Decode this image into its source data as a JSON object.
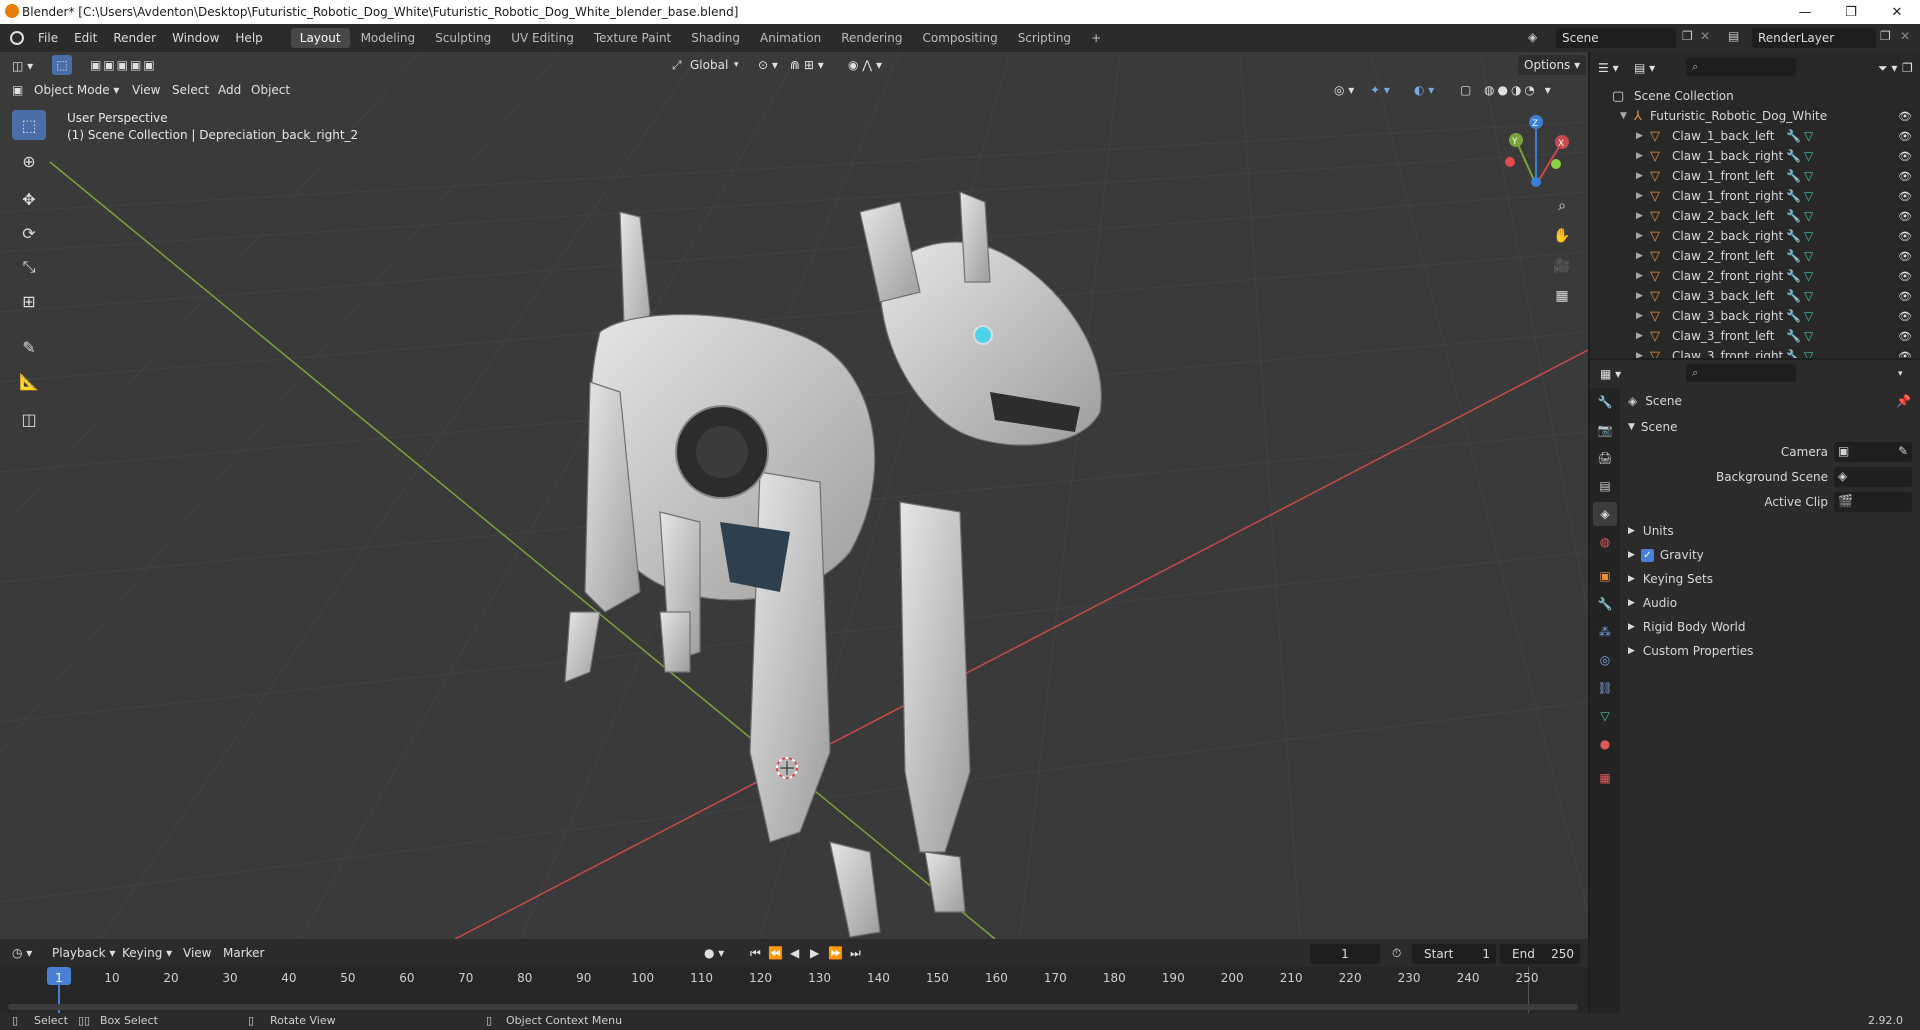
{
  "window": {
    "title": "Blender* [C:\\Users\\Avdenton\\Desktop\\Futuristic_Robotic_Dog_White\\Futuristic_Robotic_Dog_White_blender_base.blend]",
    "controls": [
      "—",
      "❐",
      "✕"
    ]
  },
  "topbar": {
    "menus": [
      "File",
      "Edit",
      "Render",
      "Window",
      "Help"
    ],
    "workspaces": [
      "Layout",
      "Modeling",
      "Sculpting",
      "UV Editing",
      "Texture Paint",
      "Shading",
      "Animation",
      "Rendering",
      "Compositing",
      "Scripting"
    ],
    "active_workspace": "Layout",
    "add_workspace": "+",
    "scene": "Scene",
    "view_layer": "RenderLayer"
  },
  "viewport": {
    "mode": "Object Mode",
    "menus": [
      "View",
      "Select",
      "Add",
      "Object"
    ],
    "transform_orientation": "Global",
    "options_label": "Options",
    "info_line1": "User Perspective",
    "info_line2": "(1) Scene Collection | Depreciation_back_right_2",
    "gizmo": {
      "x": "X",
      "y": "Y",
      "z": "Z"
    },
    "colors": {
      "x_axis": "#c84a4a",
      "y_axis": "#7aa33a",
      "z_axis": "#3d7fd6",
      "grid": "#3f3f3f",
      "background": "#3a3a3a",
      "accent": "#4a6ea8"
    }
  },
  "outliner": {
    "root": "Scene Collection",
    "collection": "Futuristic_Robotic_Dog_White",
    "items": [
      "Claw_1_back_left",
      "Claw_1_back_right",
      "Claw_1_front_left",
      "Claw_1_front_right",
      "Claw_2_back_left",
      "Claw_2_back_right",
      "Claw_2_front_left",
      "Claw_2_front_right",
      "Claw_3_back_left",
      "Claw_3_back_right",
      "Claw_3_front_left",
      "Claw_3_front_right"
    ]
  },
  "properties": {
    "context": "Scene",
    "panel": "Scene",
    "fields": {
      "camera": "Camera",
      "background_scene": "Background Scene",
      "active_clip": "Active Clip"
    },
    "sections": {
      "units": "Units",
      "gravity": "Gravity",
      "keying_sets": "Keying Sets",
      "audio": "Audio",
      "rigid_body_world": "Rigid Body World",
      "custom_properties": "Custom Properties"
    },
    "gravity_checked": true
  },
  "timeline": {
    "menus": [
      "Playback",
      "Keying",
      "View",
      "Marker"
    ],
    "current_frame": "1",
    "start_label": "Start",
    "start_value": "1",
    "end_label": "End",
    "end_value": "250",
    "ticks": [
      "1",
      "10",
      "20",
      "30",
      "40",
      "50",
      "60",
      "70",
      "80",
      "90",
      "100",
      "110",
      "120",
      "130",
      "140",
      "150",
      "160",
      "170",
      "180",
      "190",
      "200",
      "210",
      "220",
      "230",
      "240",
      "250"
    ]
  },
  "statusbar": {
    "select": "Select",
    "box_select": "Box Select",
    "rotate_view": "Rotate View",
    "context_menu": "Object Context Menu",
    "version": "2.92.0"
  }
}
